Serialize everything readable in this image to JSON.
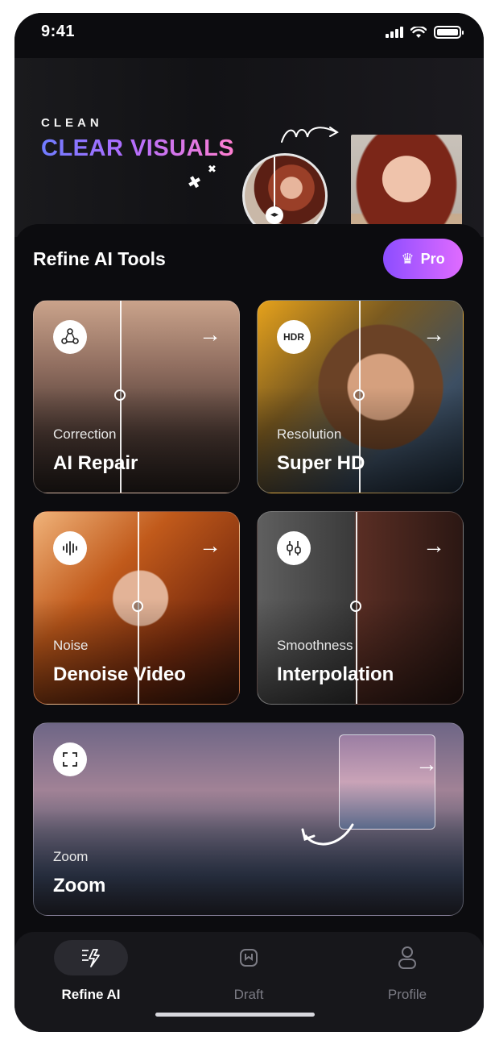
{
  "status_bar": {
    "time": "9:41",
    "icons": [
      "signal-icon",
      "wifi-icon",
      "battery-icon"
    ]
  },
  "banner": {
    "eyebrow": "CLEAN",
    "title": "CLEAR VISUALS",
    "gradient_colors": [
      "#6f7cff",
      "#b16dff",
      "#ff7fd0"
    ]
  },
  "section": {
    "title": "Refine AI Tools"
  },
  "pro_button": {
    "label": "Pro",
    "icon": "crown-icon",
    "colors": [
      "#8c4dff",
      "#e06bff"
    ]
  },
  "tools": [
    {
      "category": "Correction",
      "name": "AI Repair",
      "icon": "repair-icon",
      "arrow": "→"
    },
    {
      "category": "Resolution",
      "name": "Super HD",
      "icon": "hdr-icon",
      "icon_text": "HDR",
      "arrow": "→"
    },
    {
      "category": "Noise",
      "name": "Denoise Video",
      "icon": "waveform-icon",
      "arrow": "→"
    },
    {
      "category": "Smoothness",
      "name": "Interpolation",
      "icon": "sliders-icon",
      "arrow": "→"
    },
    {
      "category": "Zoom",
      "name": "Zoom",
      "icon": "expand-icon",
      "arrow": "→"
    }
  ],
  "tabbar": {
    "tabs": [
      {
        "label": "Refine AI",
        "icon": "sparkle-icon",
        "active": true
      },
      {
        "label": "Draft",
        "icon": "draft-icon",
        "active": false
      },
      {
        "label": "Profile",
        "icon": "profile-icon",
        "active": false
      }
    ]
  }
}
